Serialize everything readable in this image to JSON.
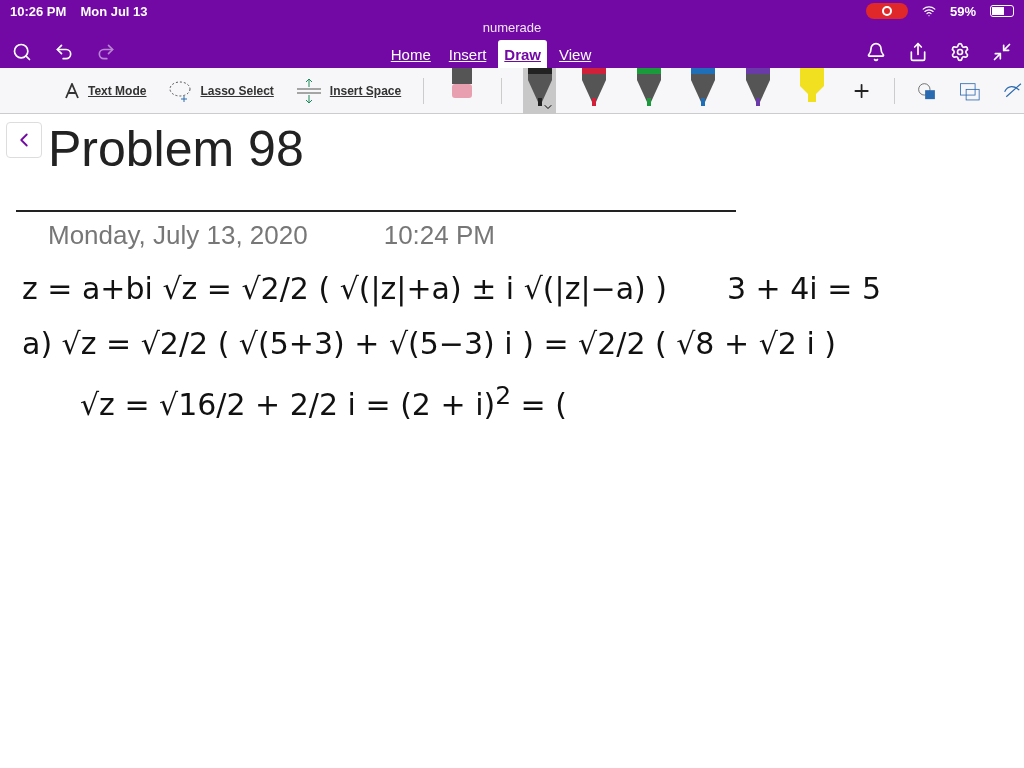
{
  "status_bar": {
    "time": "10:26 PM",
    "date": "Mon Jul 13",
    "battery": "59%",
    "recording": true
  },
  "app_title": "numerade",
  "tabs": [
    {
      "label": "Home",
      "selected": false
    },
    {
      "label": "Insert",
      "selected": false
    },
    {
      "label": "Draw",
      "selected": true
    },
    {
      "label": "View",
      "selected": false
    }
  ],
  "tools": [
    {
      "kind": "text",
      "label": "Text Mode"
    },
    {
      "kind": "lasso",
      "label": "Lasso Select"
    },
    {
      "kind": "space",
      "label": "Insert Space"
    }
  ],
  "pens": [
    {
      "kind": "eraser",
      "color": "#e8a0b0",
      "selected": false
    },
    {
      "kind": "pen",
      "color": "#222222",
      "selected": true
    },
    {
      "kind": "pen",
      "color": "#d0203a",
      "selected": false
    },
    {
      "kind": "pen",
      "color": "#1a9a3a",
      "selected": false
    },
    {
      "kind": "pen",
      "color": "#1f6fb8",
      "selected": false
    },
    {
      "kind": "pen",
      "color": "#6a3aa8",
      "selected": false
    },
    {
      "kind": "highlighter",
      "color": "#f0e020",
      "selected": false
    }
  ],
  "page": {
    "title": "Problem 98",
    "date": "Monday, July 13, 2020",
    "time": "10:24 PM"
  },
  "ink": [
    {
      "text": "z = a+bi    √z = √2/2 ( √(|z|+a) ± i √(|z|−a) )",
      "aside": "3 + 4i = 5"
    },
    {
      "text": "a)  √z = √2/2 ( √(5+3) + √(5−3) i ) = √2/2 ( √8 + √2 i )",
      "children": [
        {
          "text": "√z = √16/2 + 2/2 i = (2 + i)$^{2}$ = ("
        }
      ]
    }
  ]
}
